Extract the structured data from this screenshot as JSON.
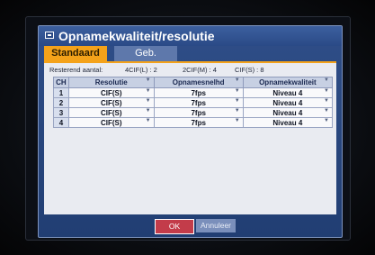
{
  "dialog": {
    "title": "Opnamekwaliteit/resolutie",
    "tabs": [
      "Standaard",
      "Geb."
    ]
  },
  "remaining": {
    "label": "Resterend aantal:",
    "cif_l": "4CIF(L) :  2",
    "cif_m": "2CIF(M) :  4",
    "cif_s": "CIF(S) :  8"
  },
  "table": {
    "headers": [
      "CH",
      "Resolutie",
      "Opnamesnelhd",
      "Opnamekwaliteit"
    ],
    "rows": [
      [
        "1",
        "CIF(S)",
        "7fps",
        "Niveau 4"
      ],
      [
        "2",
        "CIF(S)",
        "7fps",
        "Niveau 4"
      ],
      [
        "3",
        "CIF(S)",
        "7fps",
        "Niveau 4"
      ],
      [
        "4",
        "CIF(S)",
        "7fps",
        "Niveau 4"
      ]
    ]
  },
  "buttons": {
    "ok": "OK",
    "cancel": "Annuleer"
  }
}
